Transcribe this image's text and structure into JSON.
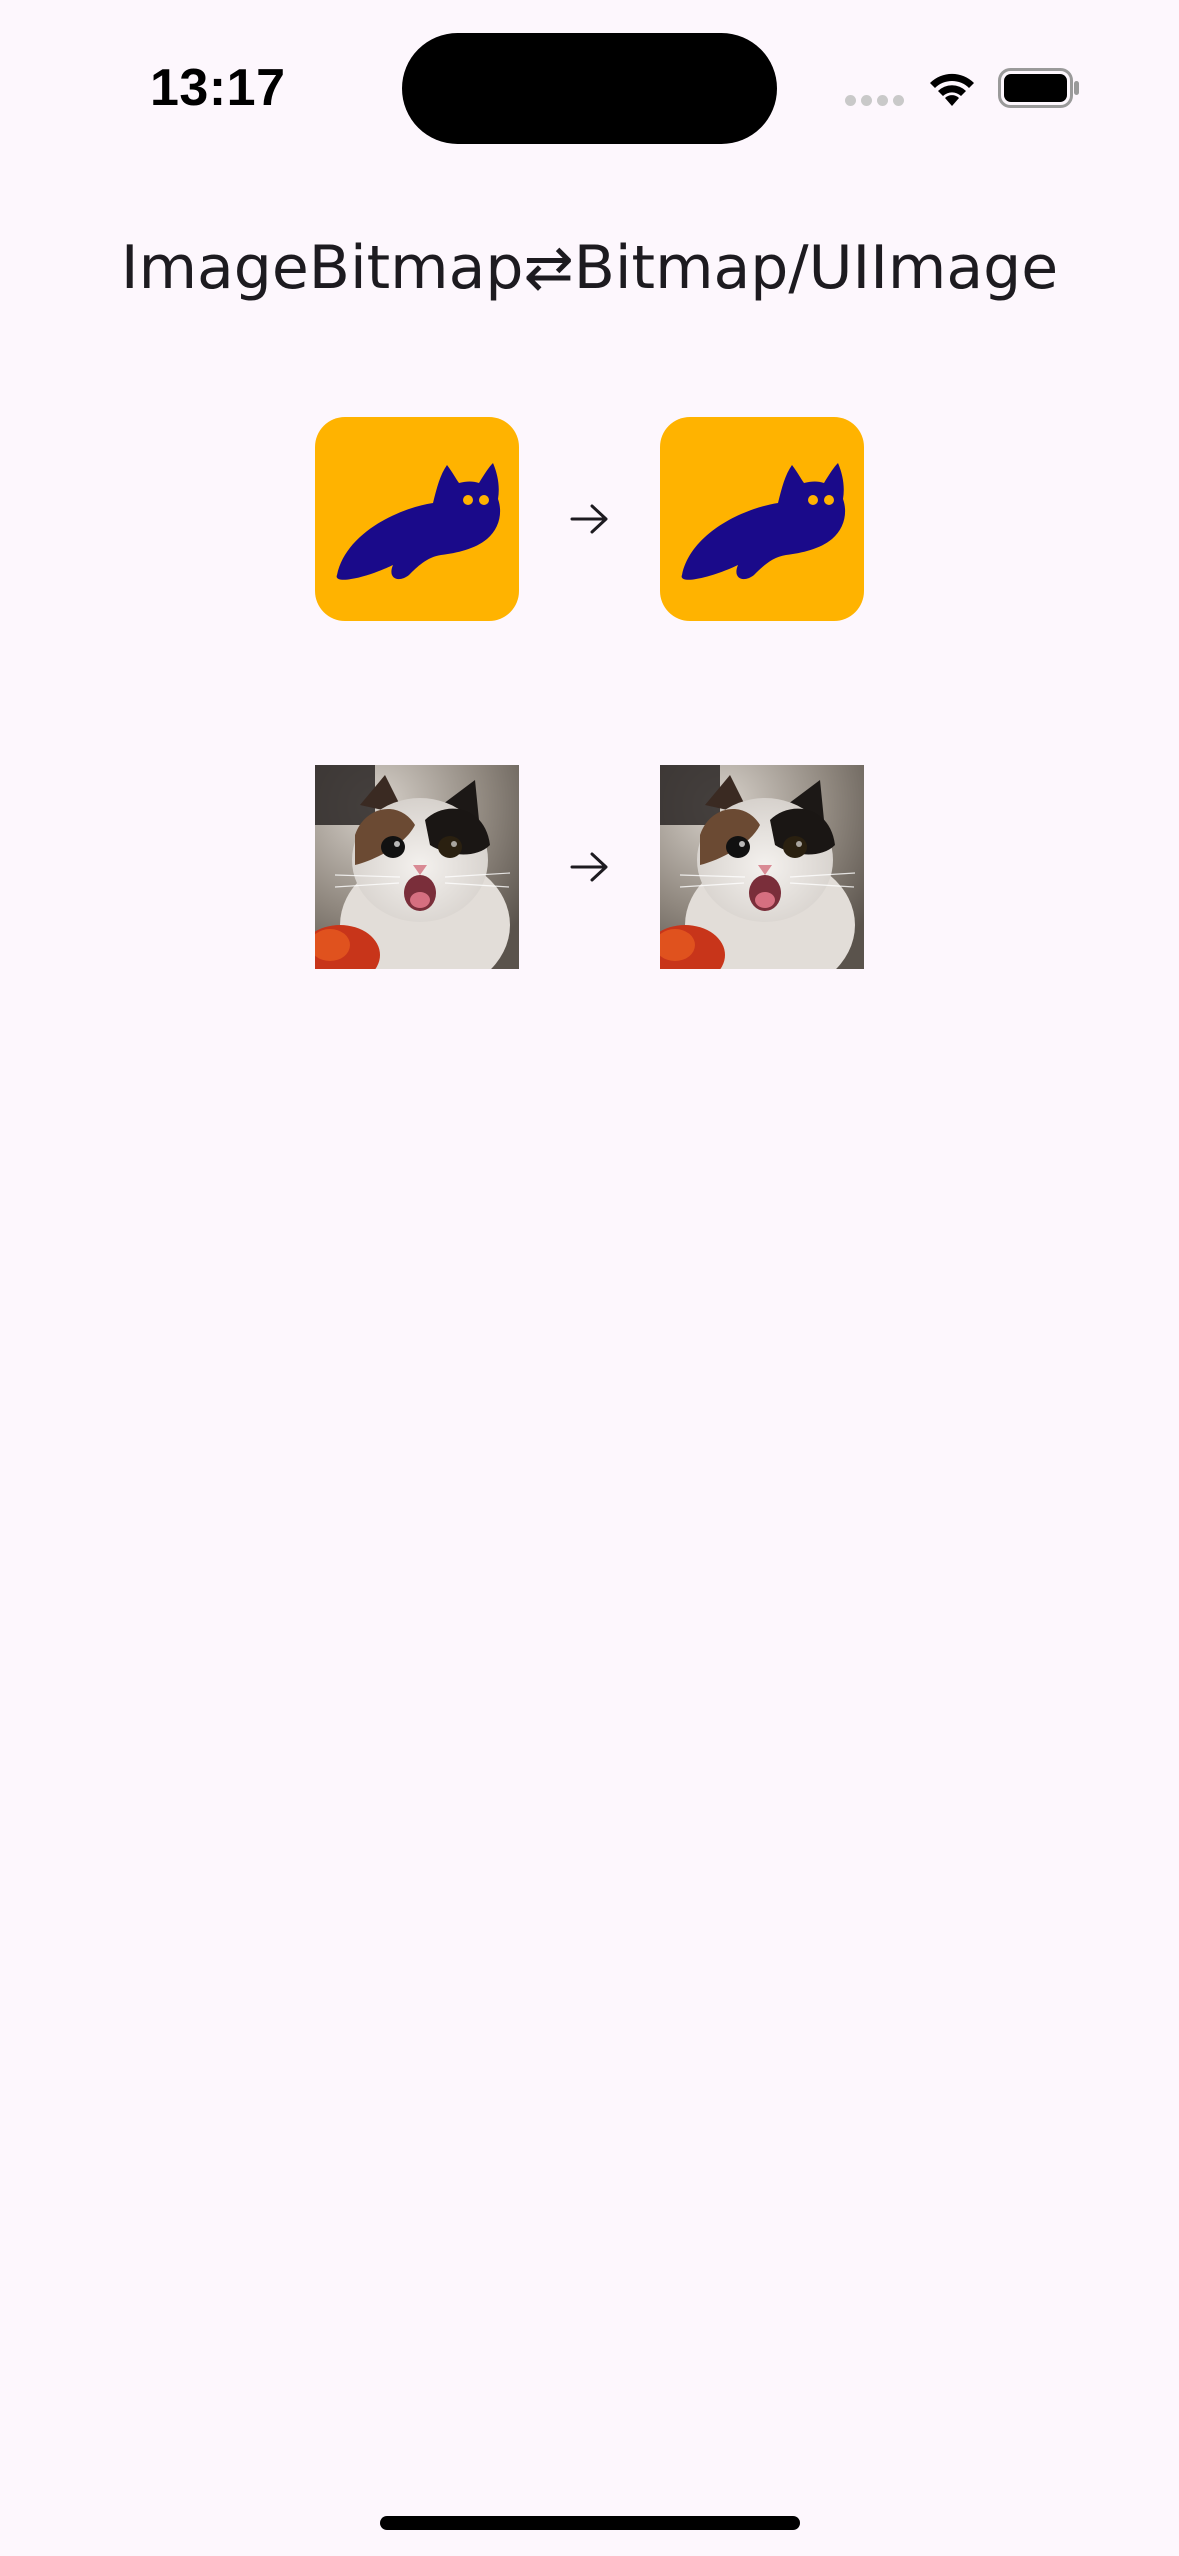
{
  "status_bar": {
    "time": "13:17",
    "icons": [
      "signal-dots-icon",
      "wifi-icon",
      "battery-icon"
    ]
  },
  "title": "ImageBitmap⇄Bitmap/UIImage",
  "conversions": [
    {
      "source": "compose-logo-image",
      "target": "compose-logo-image",
      "arrow": "arrow-right-icon"
    },
    {
      "source": "cat-photo-image",
      "target": "cat-photo-image",
      "arrow": "arrow-right-icon"
    }
  ],
  "colors": {
    "background": "#fdf7fd",
    "logo_background": "#ffb300",
    "logo_foreground": "#1a0a8a",
    "text": "#1d1b20"
  }
}
